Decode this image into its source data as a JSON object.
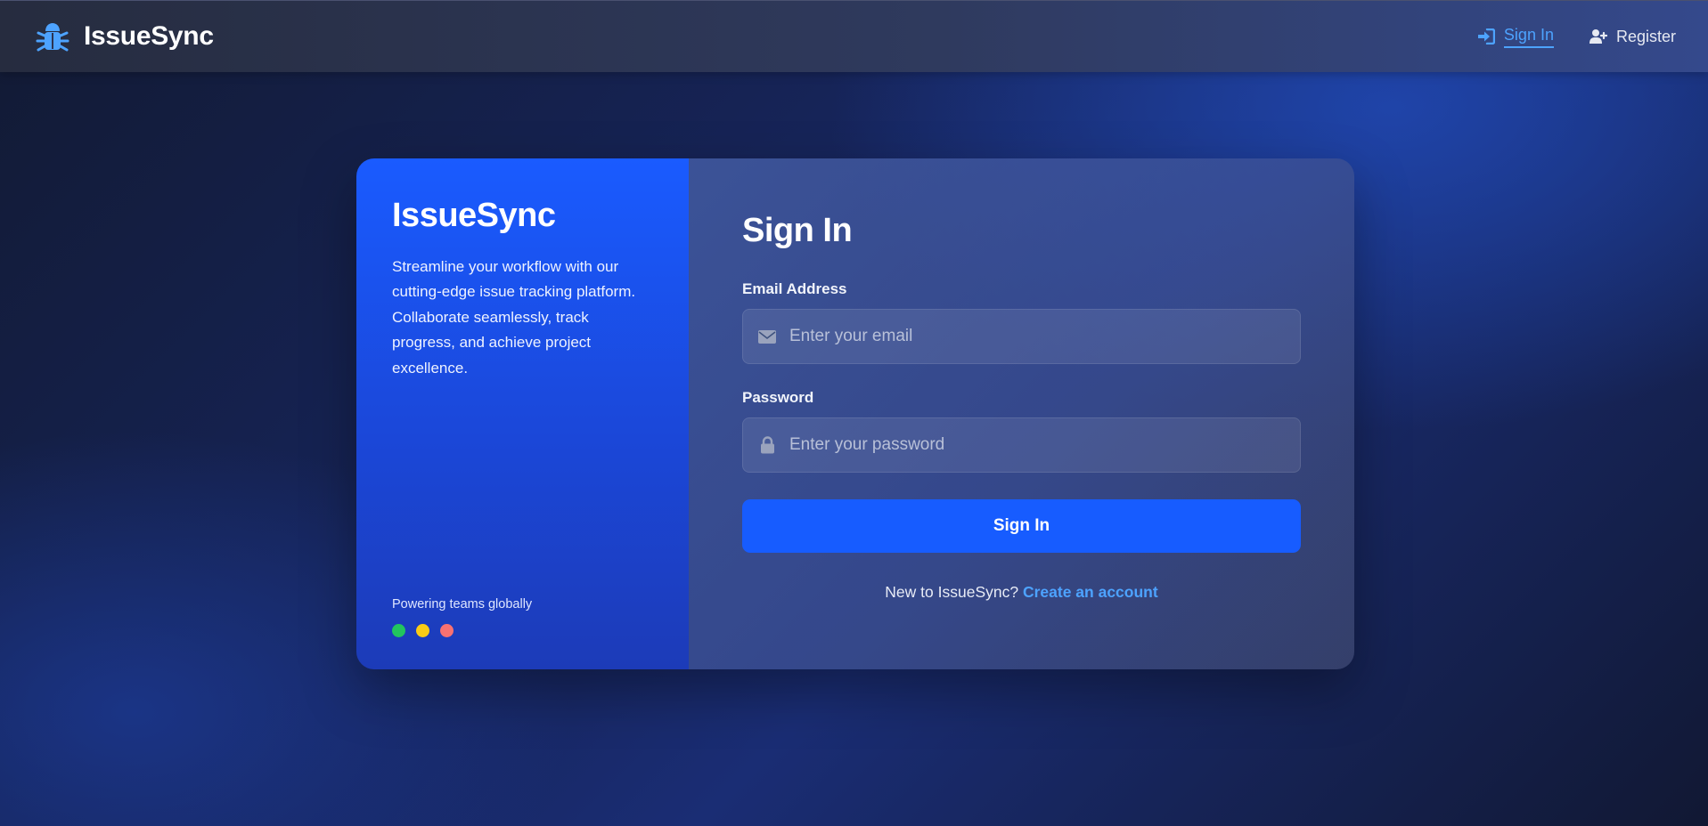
{
  "navbar": {
    "brand_name": "IssueSync",
    "brand_icon": "bug-icon",
    "links": [
      {
        "label": "Sign In",
        "icon": "sign-in-icon",
        "active": true
      },
      {
        "label": "Register",
        "icon": "user-plus-icon",
        "active": false
      }
    ]
  },
  "promo": {
    "title": "IssueSync",
    "description": "Streamline your workflow with our cutting-edge issue tracking platform. Collaborate seamlessly, track progress, and achieve project excellence.",
    "footer_text": "Powering teams globally",
    "dot_colors": [
      "#22c55e",
      "#facc15",
      "#f87171"
    ]
  },
  "form": {
    "title": "Sign In",
    "email": {
      "label": "Email Address",
      "placeholder": "Enter your email",
      "value": "",
      "icon": "envelope-icon"
    },
    "password": {
      "label": "Password",
      "placeholder": "Enter your password",
      "value": "",
      "icon": "lock-icon"
    },
    "submit_label": "Sign In",
    "signup_prompt": "New to IssueSync?",
    "signup_link": "Create an account"
  },
  "colors": {
    "accent": "#175cff",
    "link": "#4da3ff",
    "promo_panel": "#1a5bff"
  }
}
